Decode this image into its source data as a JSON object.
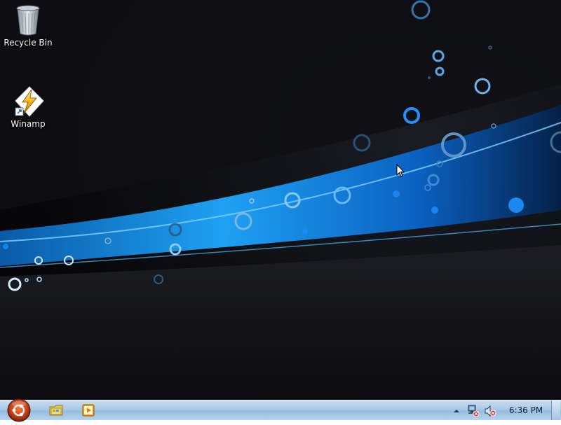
{
  "desktop": {
    "icons": [
      {
        "label": "Recycle Bin",
        "icon": "recycle-bin-icon"
      },
      {
        "label": "Winamp",
        "icon": "winamp-icon"
      }
    ]
  },
  "taskbar": {
    "start_icon": "ubuntu-start-orb-icon",
    "pinned": [
      {
        "icon": "windows-explorer-icon"
      },
      {
        "icon": "media-player-icon"
      }
    ],
    "tray": {
      "show_hidden_icon": "chevron-up-icon",
      "network_icon": "network-disconnected-icon",
      "volume_icon": "volume-muted-icon"
    },
    "clock": "6:36 PM"
  },
  "colors": {
    "accent_blue": "#1e90ff",
    "taskbar_top": "#c9dff2",
    "desktop_bg": "#0b0b0d"
  }
}
